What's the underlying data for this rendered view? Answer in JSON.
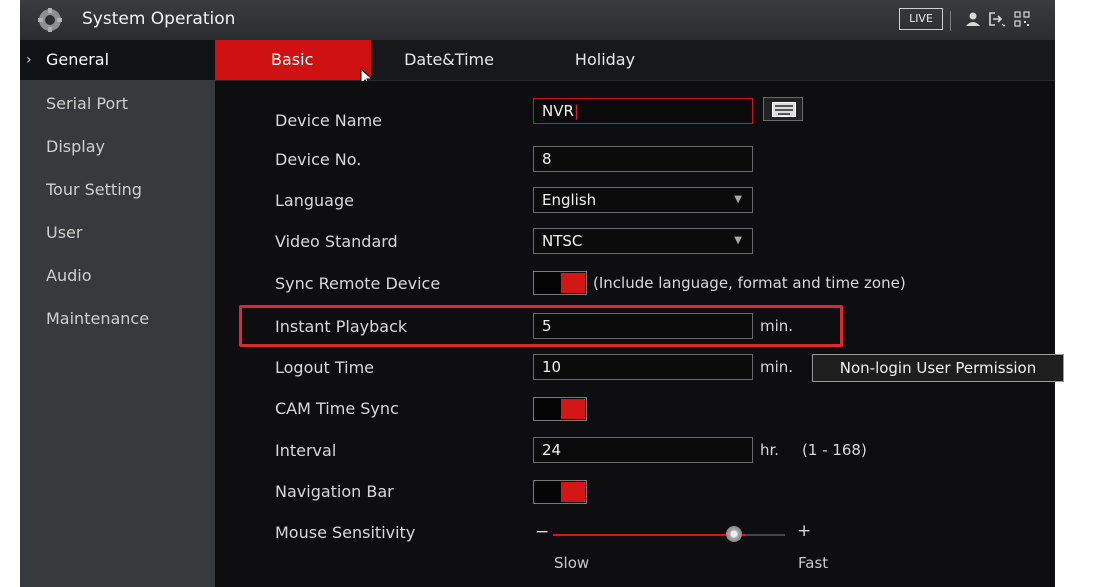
{
  "app": {
    "title": "System Operation",
    "live_label": "LIVE"
  },
  "icons": {
    "logo": "gear-logo-icon",
    "user": "user-icon",
    "logout": "logout-icon",
    "grid": "qr-grid-icon",
    "chevron": "chevron-right-icon",
    "keyboard": "keyboard-icon"
  },
  "sidebar": {
    "chevron": "›",
    "items": [
      {
        "label": "General"
      },
      {
        "label": "Serial Port"
      },
      {
        "label": "Display"
      },
      {
        "label": "Tour Setting"
      },
      {
        "label": "User"
      },
      {
        "label": "Audio"
      },
      {
        "label": "Maintenance"
      }
    ]
  },
  "tabs": [
    {
      "label": "Basic"
    },
    {
      "label": "Date&Time"
    },
    {
      "label": "Holiday"
    }
  ],
  "form": {
    "device_name": {
      "label": "Device Name",
      "value": "NVR"
    },
    "device_no": {
      "label": "Device No.",
      "value": "8"
    },
    "language": {
      "label": "Language",
      "value": "English"
    },
    "video_standard": {
      "label": "Video Standard",
      "value": "NTSC"
    },
    "sync_remote": {
      "label": "Sync Remote Device",
      "enabled": true,
      "note": "(Include language, format and time zone)"
    },
    "instant_playback": {
      "label": "Instant Playback",
      "value": "5",
      "unit": "min."
    },
    "logout_time": {
      "label": "Logout Time",
      "value": "10",
      "unit": "min.",
      "button": "Non-login User Permission"
    },
    "cam_time_sync": {
      "label": "CAM Time Sync",
      "enabled": true
    },
    "interval": {
      "label": "Interval",
      "value": "24",
      "unit": "hr.",
      "range": "(1 - 168)"
    },
    "navigation_bar": {
      "label": "Navigation Bar",
      "enabled": true
    },
    "mouse_sensitivity": {
      "label": "Mouse Sensitivity",
      "minus": "−",
      "plus": "+",
      "slow": "Slow",
      "fast": "Fast",
      "level": 0.8
    }
  },
  "colors": {
    "accent": "#cf1111",
    "highlight": "#e0262f"
  }
}
